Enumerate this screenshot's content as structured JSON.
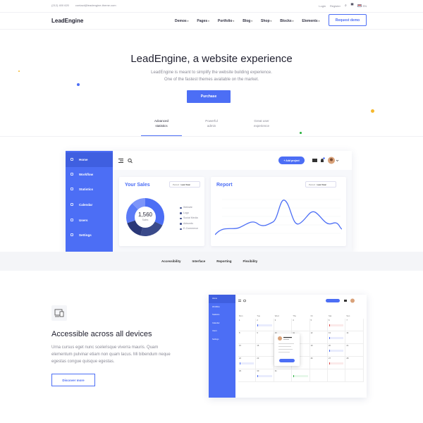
{
  "topbar": {
    "phone": "(212) 400 620",
    "email": "contact@leadengine-theme.com",
    "login": "Login",
    "register": "Register",
    "lang": "EN"
  },
  "header": {
    "logo": "LeadEngine",
    "nav": [
      "Demos",
      "Pages",
      "Portfolio",
      "Blog",
      "Shop",
      "Blocks",
      "Elements"
    ],
    "request_demo": "Request demo"
  },
  "hero": {
    "title": "LeadEngine, a website experience",
    "subtitle_line1": "LeadEngine is meant to simplify the website building experience.",
    "subtitle_line2": "One of the fastest themes available on the market.",
    "purchase": "Purchase"
  },
  "tabs": [
    {
      "line1": "Advanced",
      "line2": "statistics"
    },
    {
      "line1": "Powerful",
      "line2": "admin"
    },
    {
      "line1": "Great user",
      "line2": "experience"
    }
  ],
  "dashboard": {
    "sidebar": [
      "Home",
      "Workflow",
      "Statistics",
      "Calendar",
      "Users",
      "Settings"
    ],
    "add_project": "+ Add project",
    "sales": {
      "title": "Your Sales",
      "period_label": "Period:",
      "period_value": "Last Year",
      "total": "1,560",
      "total_label": "Sales",
      "legend": [
        "Website",
        "Logo",
        "Social Media",
        "Adwords",
        "E-Commerce"
      ]
    },
    "report": {
      "title": "Report",
      "period_label": "Period:",
      "period_value": "Last Year"
    }
  },
  "colors": {
    "accent": "#4c6ef5",
    "donut": [
      "#4c6ef5",
      "#3a4a8a",
      "#2a3878",
      "#5b7bf7",
      "#7d95f9"
    ]
  },
  "section_tabs": [
    "Accessibility",
    "Interface",
    "Reporting",
    "Flexibility"
  ],
  "feature": {
    "icon": "devices-icon",
    "title": "Accessible across all devices",
    "text": "Urna cursus eget nunc scelerisque viverra mauris. Quam elementum pulvinar etiam non quam lacus. Mi bibendum neque egestas congue quisque egestas.",
    "button": "Discover more"
  },
  "calendar": {
    "days": [
      "Mon",
      "Tue",
      "Wed",
      "Thu",
      "Fri",
      "Sat",
      "Sun"
    ]
  }
}
